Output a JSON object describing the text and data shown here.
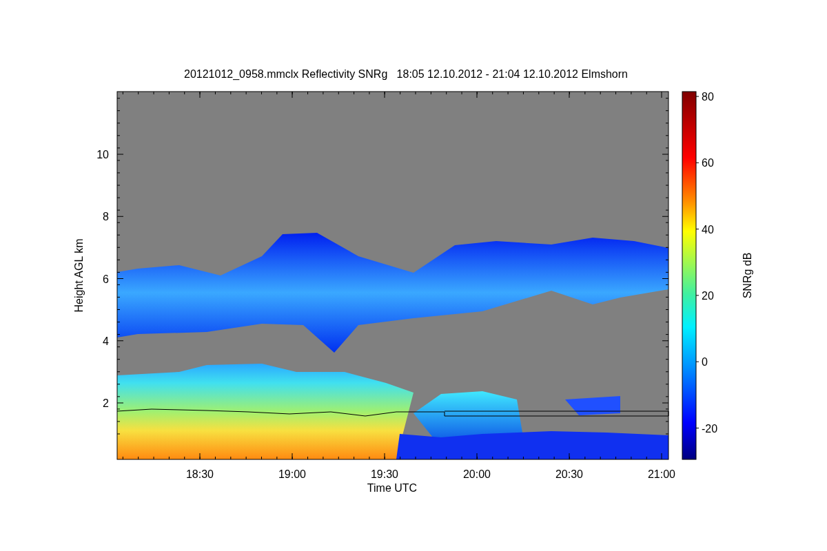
{
  "title": "20121012_0958.mmclx Reflectivity SNRg   18:05 12.10.2012 - 21:04 12.10.2012 Elmshorn",
  "y_axis": {
    "label": "Height AGL km",
    "ticks": [
      "10",
      "8",
      "6",
      "4",
      "2"
    ]
  },
  "x_axis": {
    "label": "Time UTC",
    "ticks": [
      "18:30",
      "19:00",
      "19:30",
      "20:00",
      "20:30",
      "21:00"
    ]
  },
  "colorbar": {
    "label": "SNRg dB",
    "ticks": [
      "80",
      "60",
      "40",
      "20",
      "0",
      "-20"
    ]
  }
}
